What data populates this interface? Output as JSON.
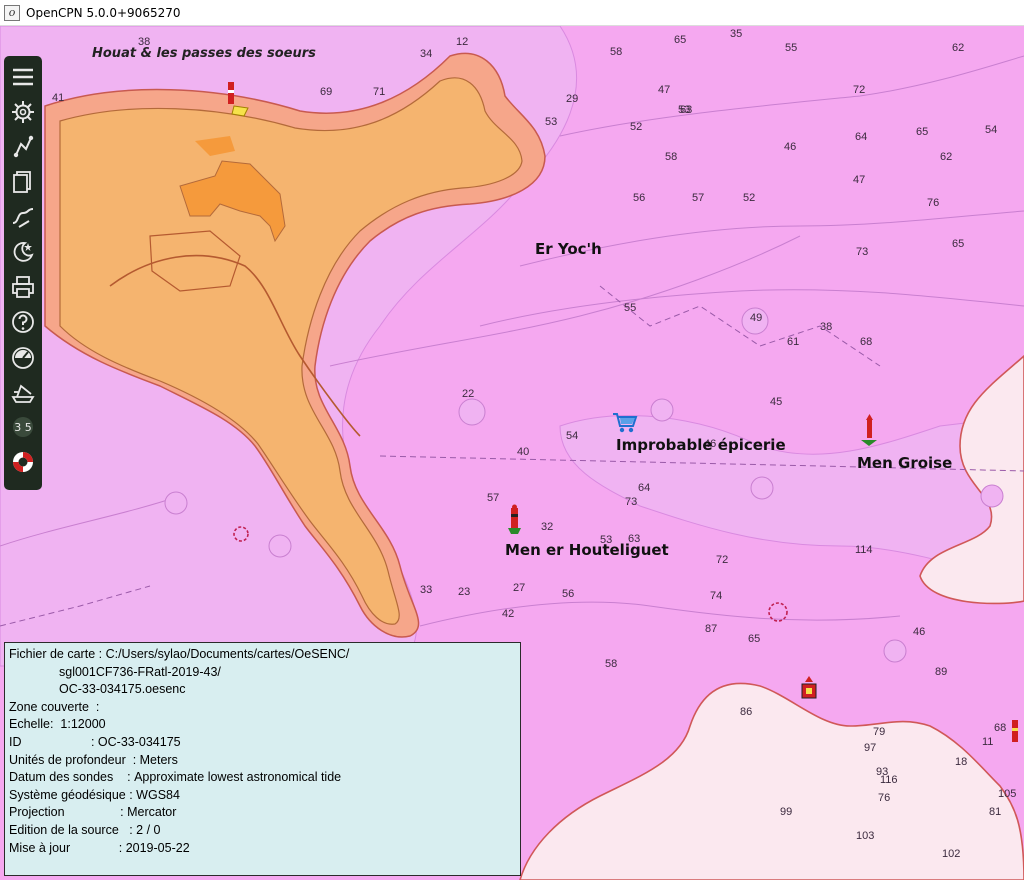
{
  "window": {
    "title": "OpenCPN 5.0.0+9065270",
    "app_icon": "opencpn-logo-icon"
  },
  "chart": {
    "name": "Houat & les passes des soeurs",
    "colors": {
      "deep_water": "#f5a8f0",
      "mid_water": "#f0b3f2",
      "shallow_water": "#fbe8ef",
      "land": "#f5b46f",
      "land_dark": "#f59a3c",
      "drying": "#f3a6a2"
    },
    "labels": [
      {
        "id": "er-yoch",
        "text": "Er Yoc'h"
      },
      {
        "id": "improbable-epicerie",
        "text": "Improbable épicerie"
      },
      {
        "id": "men-groise",
        "text": "Men Groise"
      },
      {
        "id": "men-er-houteliguet",
        "text": "Men er Houteliguet"
      }
    ],
    "soundings": [
      "38",
      "34",
      "58",
      "65",
      "35",
      "55",
      "62",
      "41",
      "12",
      "69",
      "71",
      "63",
      "72",
      "65",
      "54",
      "29",
      "53",
      "47",
      "52",
      "46",
      "64",
      "62",
      "58",
      "57",
      "56",
      "52",
      "76",
      "53",
      "47",
      "73",
      "49",
      "55",
      "61",
      "68",
      "45",
      "38",
      "65",
      "54",
      "73",
      "46",
      "27",
      "58",
      "42",
      "87",
      "79",
      "76",
      "99",
      "103",
      "102",
      "114",
      "116",
      "93",
      "86",
      "97",
      "81",
      "11",
      "105",
      "46",
      "89",
      "18",
      "68",
      "74",
      "72",
      "65",
      "63",
      "56",
      "53",
      "33",
      "23",
      "22",
      "57",
      "32",
      "40",
      "64"
    ]
  },
  "toolbar": {
    "items": [
      {
        "id": "menu",
        "icon": "hamburger-menu-icon"
      },
      {
        "id": "settings",
        "icon": "gear-icon"
      },
      {
        "id": "route",
        "icon": "route-icon"
      },
      {
        "id": "route-manager",
        "icon": "document-icon"
      },
      {
        "id": "track",
        "icon": "track-icon"
      },
      {
        "id": "tides",
        "icon": "tide-current-icon"
      },
      {
        "id": "print",
        "icon": "print-icon"
      },
      {
        "id": "help",
        "icon": "help-icon"
      },
      {
        "id": "dashboard",
        "icon": "gauge-icon"
      },
      {
        "id": "ais",
        "icon": "ship-icon"
      },
      {
        "id": "scale",
        "icon": "scale-icon"
      },
      {
        "id": "mob",
        "icon": "lifebuoy-icon"
      }
    ],
    "scale_text": "3 5"
  },
  "info_panel": {
    "fichier_label": "Fichier de carte : ",
    "fichier_line1": "C:/Users/sylao/Documents/cartes/OeSENC/",
    "fichier_line2": "sgl001CF736-FRatl-2019-43/",
    "fichier_line3": "OC-33-034175.oesenc",
    "zone_label": "Zone couverte  :",
    "zone_value": "",
    "echelle_label": "Echelle:  ",
    "echelle_value": "1:12000",
    "id_label": "ID                    : ",
    "id_value": "OC-33-034175",
    "unites_label": "Unités de profondeur  : ",
    "unites_value": "Meters",
    "datum_label": "Datum des sondes    : ",
    "datum_value": "Approximate lowest astronomical tide",
    "systeme_label": "Système géodésique : ",
    "systeme_value": "WGS84",
    "projection_label": "Projection                : ",
    "projection_value": "Mercator",
    "edition_label": "Edition de la source   : ",
    "edition_value": "2 / 0",
    "maj_label": "Mise à jour              : ",
    "maj_value": "2019-05-22"
  }
}
